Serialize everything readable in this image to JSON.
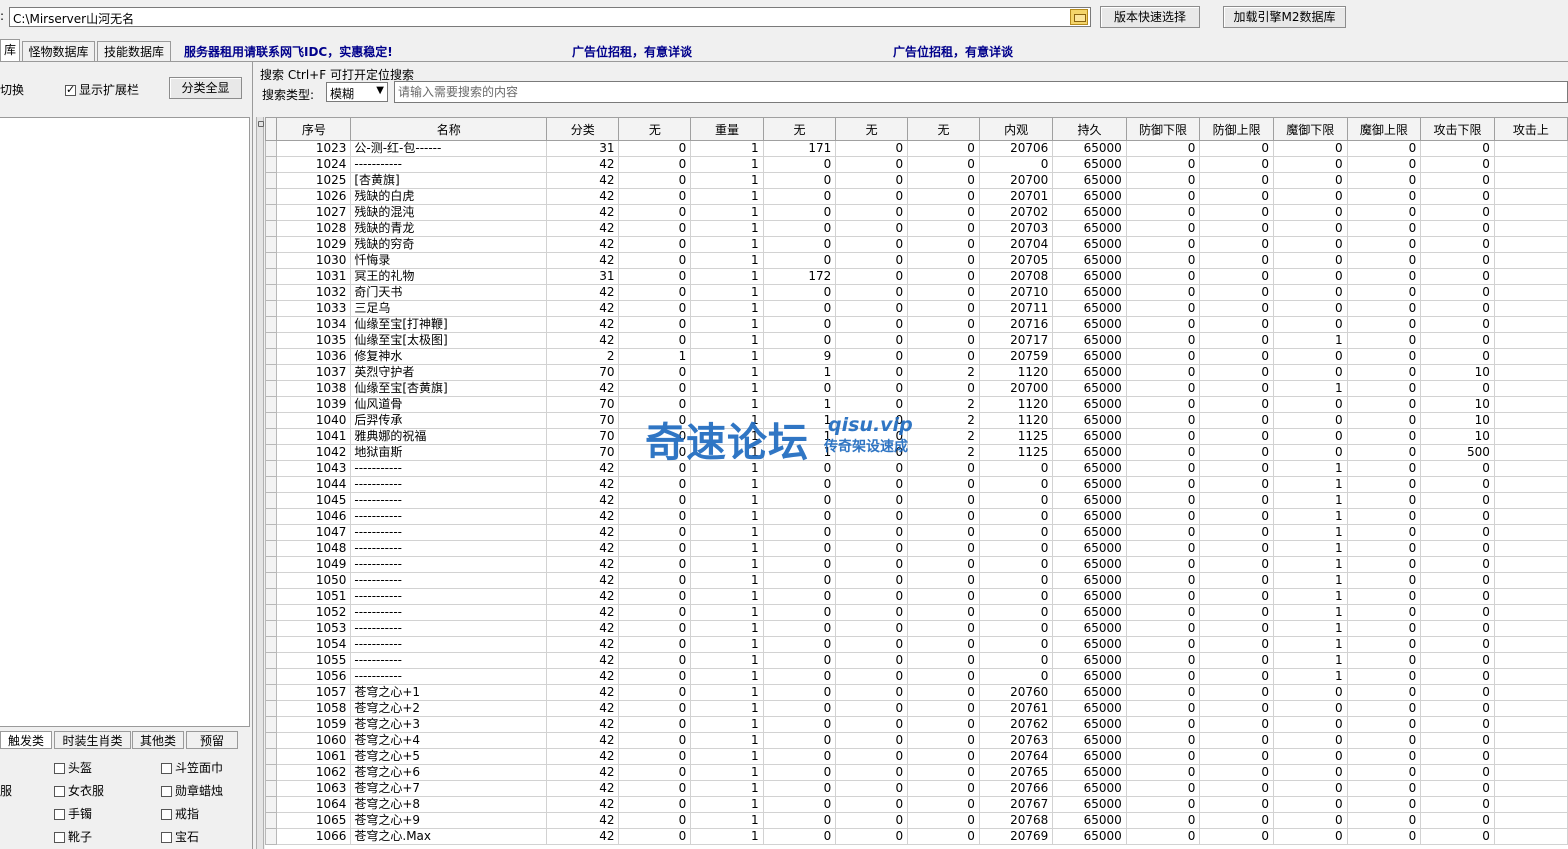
{
  "top_bar": {
    "left_label": ":",
    "path": "C:\\Mirserver山河无名",
    "version_button": "版本快速选择",
    "load_db_button": "加载引擎M2数据库"
  },
  "tabs": [
    {
      "label": "库"
    },
    {
      "label": "怪物数据库"
    },
    {
      "label": "技能数据库"
    }
  ],
  "promos": {
    "server": "服务器租用请联系网飞IDC，实惠稳定!",
    "ad1": "广告位招租，有意详谈",
    "ad2": "广告位招租，有意详谈"
  },
  "left_panel": {
    "switch_label": "切换",
    "show_ext_label": "显示扩展栏",
    "show_ext_checked": true,
    "show_all_button": "分类全显",
    "bottom_tabs": [
      {
        "label": "触发类"
      },
      {
        "label": "时装生肖类"
      },
      {
        "label": "其他类"
      },
      {
        "label": "预留"
      }
    ],
    "left_edge_label": "服",
    "category_checks": [
      {
        "label": "头盔"
      },
      {
        "label": "斗笠面巾"
      },
      {
        "label": "女衣服"
      },
      {
        "label": "勋章蜡烛"
      },
      {
        "label": "手镯"
      },
      {
        "label": "戒指"
      },
      {
        "label": "靴子"
      },
      {
        "label": "宝石"
      }
    ]
  },
  "search": {
    "title": "搜索  Ctrl+F 可打开定位搜索",
    "type_label": "搜索类型:",
    "type_value": "模糊",
    "placeholder": "请输入需要搜索的内容"
  },
  "table": {
    "columns": [
      "序号",
      "名称",
      "分类",
      "无",
      "重量",
      "无",
      "无",
      "无",
      "内观",
      "持久",
      "防御下限",
      "防御上限",
      "魔御下限",
      "魔御上限",
      "攻击下限",
      "攻击上"
    ],
    "rows": [
      [
        "1023",
        "公-测-红-包------",
        "31",
        "0",
        "1",
        "171",
        "0",
        "0",
        "20706",
        "65000",
        "0",
        "0",
        "0",
        "0",
        "0",
        ""
      ],
      [
        "1024",
        "-----------",
        "42",
        "0",
        "1",
        "0",
        "0",
        "0",
        "0",
        "65000",
        "0",
        "0",
        "0",
        "0",
        "0",
        ""
      ],
      [
        "1025",
        "[杏黄旗]",
        "42",
        "0",
        "1",
        "0",
        "0",
        "0",
        "20700",
        "65000",
        "0",
        "0",
        "0",
        "0",
        "0",
        ""
      ],
      [
        "1026",
        "残缺的白虎",
        "42",
        "0",
        "1",
        "0",
        "0",
        "0",
        "20701",
        "65000",
        "0",
        "0",
        "0",
        "0",
        "0",
        ""
      ],
      [
        "1027",
        "残缺的混沌",
        "42",
        "0",
        "1",
        "0",
        "0",
        "0",
        "20702",
        "65000",
        "0",
        "0",
        "0",
        "0",
        "0",
        ""
      ],
      [
        "1028",
        "残缺的青龙",
        "42",
        "0",
        "1",
        "0",
        "0",
        "0",
        "20703",
        "65000",
        "0",
        "0",
        "0",
        "0",
        "0",
        ""
      ],
      [
        "1029",
        "残缺的穷奇",
        "42",
        "0",
        "1",
        "0",
        "0",
        "0",
        "20704",
        "65000",
        "0",
        "0",
        "0",
        "0",
        "0",
        ""
      ],
      [
        "1030",
        "忏悔录",
        "42",
        "0",
        "1",
        "0",
        "0",
        "0",
        "20705",
        "65000",
        "0",
        "0",
        "0",
        "0",
        "0",
        ""
      ],
      [
        "1031",
        "冥王的礼物",
        "31",
        "0",
        "1",
        "172",
        "0",
        "0",
        "20708",
        "65000",
        "0",
        "0",
        "0",
        "0",
        "0",
        ""
      ],
      [
        "1032",
        "奇门天书",
        "42",
        "0",
        "1",
        "0",
        "0",
        "0",
        "20710",
        "65000",
        "0",
        "0",
        "0",
        "0",
        "0",
        ""
      ],
      [
        "1033",
        "三足乌",
        "42",
        "0",
        "1",
        "0",
        "0",
        "0",
        "20711",
        "65000",
        "0",
        "0",
        "0",
        "0",
        "0",
        ""
      ],
      [
        "1034",
        "仙缘至宝[打神鞭]",
        "42",
        "0",
        "1",
        "0",
        "0",
        "0",
        "20716",
        "65000",
        "0",
        "0",
        "0",
        "0",
        "0",
        ""
      ],
      [
        "1035",
        "仙缘至宝[太极图]",
        "42",
        "0",
        "1",
        "0",
        "0",
        "0",
        "20717",
        "65000",
        "0",
        "0",
        "1",
        "0",
        "0",
        ""
      ],
      [
        "1036",
        "修复神水",
        "2",
        "1",
        "1",
        "9",
        "0",
        "0",
        "20759",
        "65000",
        "0",
        "0",
        "0",
        "0",
        "0",
        ""
      ],
      [
        "1037",
        "英烈守护者",
        "70",
        "0",
        "1",
        "1",
        "0",
        "2",
        "1120",
        "65000",
        "0",
        "0",
        "0",
        "0",
        "10",
        ""
      ],
      [
        "1038",
        "仙缘至宝[杏黄旗]",
        "42",
        "0",
        "1",
        "0",
        "0",
        "0",
        "20700",
        "65000",
        "0",
        "0",
        "1",
        "0",
        "0",
        ""
      ],
      [
        "1039",
        "仙风道骨",
        "70",
        "0",
        "1",
        "1",
        "0",
        "2",
        "1120",
        "65000",
        "0",
        "0",
        "0",
        "0",
        "10",
        ""
      ],
      [
        "1040",
        "后羿传承",
        "70",
        "0",
        "1",
        "1",
        "0",
        "2",
        "1120",
        "65000",
        "0",
        "0",
        "0",
        "0",
        "10",
        ""
      ],
      [
        "1041",
        "雅典娜的祝福",
        "70",
        "0",
        "1",
        "1",
        "0",
        "2",
        "1125",
        "65000",
        "0",
        "0",
        "0",
        "0",
        "10",
        ""
      ],
      [
        "1042",
        "地狱亩斯",
        "70",
        "0",
        "1",
        "1",
        "0",
        "2",
        "1125",
        "65000",
        "0",
        "0",
        "0",
        "0",
        "500",
        ""
      ],
      [
        "1043",
        "-----------",
        "42",
        "0",
        "1",
        "0",
        "0",
        "0",
        "0",
        "65000",
        "0",
        "0",
        "1",
        "0",
        "0",
        ""
      ],
      [
        "1044",
        "-----------",
        "42",
        "0",
        "1",
        "0",
        "0",
        "0",
        "0",
        "65000",
        "0",
        "0",
        "1",
        "0",
        "0",
        ""
      ],
      [
        "1045",
        "-----------",
        "42",
        "0",
        "1",
        "0",
        "0",
        "0",
        "0",
        "65000",
        "0",
        "0",
        "1",
        "0",
        "0",
        ""
      ],
      [
        "1046",
        "-----------",
        "42",
        "0",
        "1",
        "0",
        "0",
        "0",
        "0",
        "65000",
        "0",
        "0",
        "1",
        "0",
        "0",
        ""
      ],
      [
        "1047",
        "-----------",
        "42",
        "0",
        "1",
        "0",
        "0",
        "0",
        "0",
        "65000",
        "0",
        "0",
        "1",
        "0",
        "0",
        ""
      ],
      [
        "1048",
        "-----------",
        "42",
        "0",
        "1",
        "0",
        "0",
        "0",
        "0",
        "65000",
        "0",
        "0",
        "1",
        "0",
        "0",
        ""
      ],
      [
        "1049",
        "-----------",
        "42",
        "0",
        "1",
        "0",
        "0",
        "0",
        "0",
        "65000",
        "0",
        "0",
        "1",
        "0",
        "0",
        ""
      ],
      [
        "1050",
        "-----------",
        "42",
        "0",
        "1",
        "0",
        "0",
        "0",
        "0",
        "65000",
        "0",
        "0",
        "1",
        "0",
        "0",
        ""
      ],
      [
        "1051",
        "-----------",
        "42",
        "0",
        "1",
        "0",
        "0",
        "0",
        "0",
        "65000",
        "0",
        "0",
        "1",
        "0",
        "0",
        ""
      ],
      [
        "1052",
        "-----------",
        "42",
        "0",
        "1",
        "0",
        "0",
        "0",
        "0",
        "65000",
        "0",
        "0",
        "1",
        "0",
        "0",
        ""
      ],
      [
        "1053",
        "-----------",
        "42",
        "0",
        "1",
        "0",
        "0",
        "0",
        "0",
        "65000",
        "0",
        "0",
        "1",
        "0",
        "0",
        ""
      ],
      [
        "1054",
        "-----------",
        "42",
        "0",
        "1",
        "0",
        "0",
        "0",
        "0",
        "65000",
        "0",
        "0",
        "1",
        "0",
        "0",
        ""
      ],
      [
        "1055",
        "-----------",
        "42",
        "0",
        "1",
        "0",
        "0",
        "0",
        "0",
        "65000",
        "0",
        "0",
        "1",
        "0",
        "0",
        ""
      ],
      [
        "1056",
        "-----------",
        "42",
        "0",
        "1",
        "0",
        "0",
        "0",
        "0",
        "65000",
        "0",
        "0",
        "1",
        "0",
        "0",
        ""
      ],
      [
        "1057",
        "苍穹之心+1",
        "42",
        "0",
        "1",
        "0",
        "0",
        "0",
        "20760",
        "65000",
        "0",
        "0",
        "0",
        "0",
        "0",
        ""
      ],
      [
        "1058",
        "苍穹之心+2",
        "42",
        "0",
        "1",
        "0",
        "0",
        "0",
        "20761",
        "65000",
        "0",
        "0",
        "0",
        "0",
        "0",
        ""
      ],
      [
        "1059",
        "苍穹之心+3",
        "42",
        "0",
        "1",
        "0",
        "0",
        "0",
        "20762",
        "65000",
        "0",
        "0",
        "0",
        "0",
        "0",
        ""
      ],
      [
        "1060",
        "苍穹之心+4",
        "42",
        "0",
        "1",
        "0",
        "0",
        "0",
        "20763",
        "65000",
        "0",
        "0",
        "0",
        "0",
        "0",
        ""
      ],
      [
        "1061",
        "苍穹之心+5",
        "42",
        "0",
        "1",
        "0",
        "0",
        "0",
        "20764",
        "65000",
        "0",
        "0",
        "0",
        "0",
        "0",
        ""
      ],
      [
        "1062",
        "苍穹之心+6",
        "42",
        "0",
        "1",
        "0",
        "0",
        "0",
        "20765",
        "65000",
        "0",
        "0",
        "0",
        "0",
        "0",
        ""
      ],
      [
        "1063",
        "苍穹之心+7",
        "42",
        "0",
        "1",
        "0",
        "0",
        "0",
        "20766",
        "65000",
        "0",
        "0",
        "0",
        "0",
        "0",
        ""
      ],
      [
        "1064",
        "苍穹之心+8",
        "42",
        "0",
        "1",
        "0",
        "0",
        "0",
        "20767",
        "65000",
        "0",
        "0",
        "0",
        "0",
        "0",
        ""
      ],
      [
        "1065",
        "苍穹之心+9",
        "42",
        "0",
        "1",
        "0",
        "0",
        "0",
        "20768",
        "65000",
        "0",
        "0",
        "0",
        "0",
        "0",
        ""
      ],
      [
        "1066",
        "苍穹之心.Max",
        "42",
        "0",
        "1",
        "0",
        "0",
        "0",
        "20769",
        "65000",
        "0",
        "0",
        "0",
        "0",
        "0",
        ""
      ]
    ]
  },
  "watermark": {
    "main": "奇速论坛",
    "domain": "qisu.vip",
    "tagline": "传奇架设速成"
  }
}
